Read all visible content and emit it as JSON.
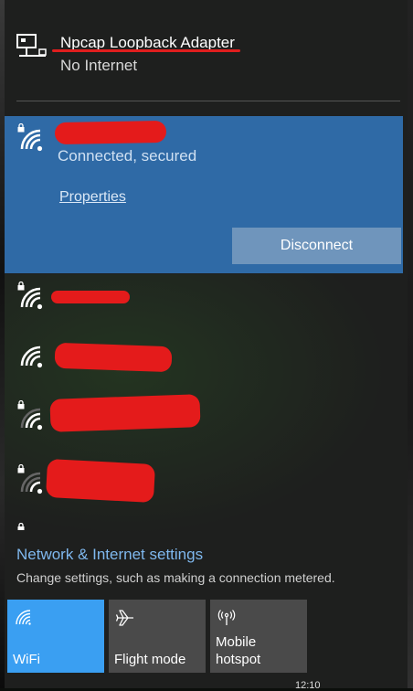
{
  "ethernet": {
    "name": "Npcap Loopback Adapter",
    "status": "No Internet"
  },
  "connected_network": {
    "status": "Connected, secured",
    "properties_link": "Properties",
    "disconnect_label": "Disconnect"
  },
  "networks_count": 5,
  "settings": {
    "link": "Network & Internet settings",
    "description": "Change settings, such as making a connection metered."
  },
  "quick_actions": [
    {
      "label": "WiFi",
      "icon": "wifi-icon",
      "active": true
    },
    {
      "label": "Flight mode",
      "icon": "airplane-icon",
      "active": false
    },
    {
      "label": "Mobile hotspot",
      "icon": "hotspot-icon",
      "active": false
    }
  ],
  "taskbar_clock": "12:10",
  "colors": {
    "accent": "#3a9ff2",
    "selected_bg": "#2f6aa6",
    "flyout_bg": "#1e1f1e",
    "link": "#7fb8ee",
    "redaction": "#e41b1b"
  }
}
